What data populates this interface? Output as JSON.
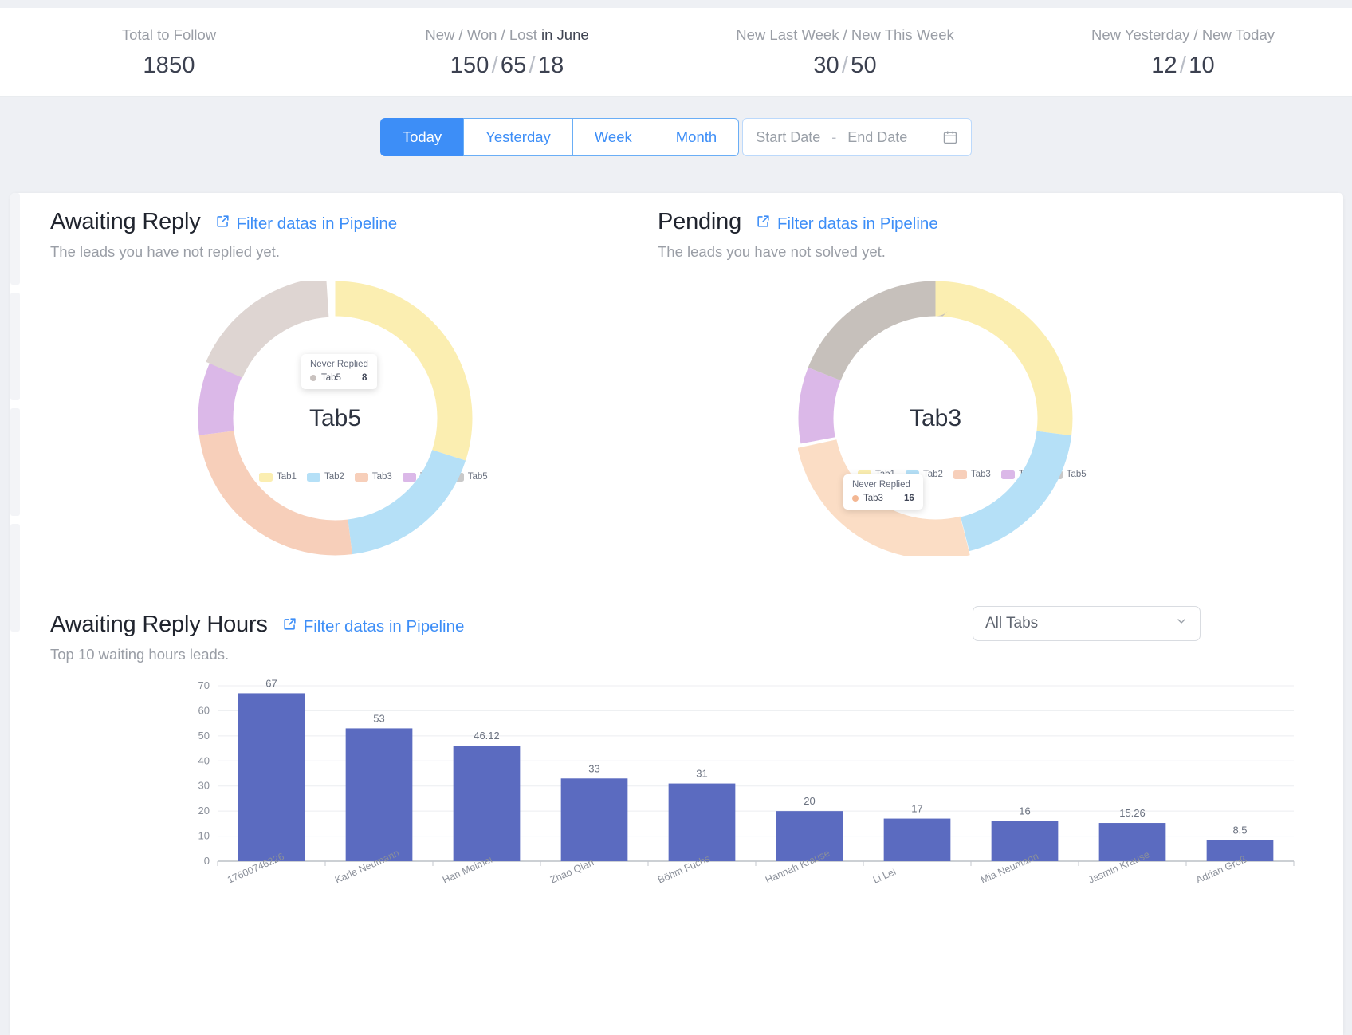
{
  "stats": [
    {
      "label_plain": "Total to Follow",
      "label_strong": "",
      "value": "1850",
      "parts": []
    },
    {
      "label_plain": "New / Won / Lost ",
      "label_strong": "in June",
      "value": "",
      "parts": [
        "150",
        "65",
        "18"
      ]
    },
    {
      "label_plain": "New Last Week / New This Week",
      "label_strong": "",
      "value": "",
      "parts": [
        "30",
        "50"
      ]
    },
    {
      "label_plain": "New Yesterday / New Today",
      "label_strong": "",
      "value": "",
      "parts": [
        "12",
        "10"
      ]
    }
  ],
  "filters": {
    "segments": [
      {
        "label": "Today",
        "active": true
      },
      {
        "label": "Yesterday",
        "active": false
      },
      {
        "label": "Week",
        "active": false
      },
      {
        "label": "Month",
        "active": false
      }
    ],
    "start_date_placeholder": "Start Date",
    "range_dash": "-",
    "end_date_placeholder": "End Date",
    "calendar_icon": "calendar-icon"
  },
  "colors": {
    "accent_blue": "#3d8ef7",
    "bar_purple": "#5b6bc0",
    "tab1": "#fbeeb1",
    "tab2": "#b5e0f7",
    "tab3": "#f7cfba",
    "tab4": "#dbb8e8",
    "tab5": "#ded5d2",
    "tab5_pending": "#c6c0bb",
    "tab3_pending": "#fbddc5"
  },
  "awaiting_reply": {
    "title": "Awaiting Reply",
    "link": "Filter datas in Pipeline",
    "subtitle": "The leads you have not replied yet.",
    "center_label": "Tab5",
    "tooltip": {
      "title": "Never Replied",
      "name": "Tab5",
      "value": "8"
    },
    "legend": [
      "Tab1",
      "Tab2",
      "Tab3",
      "Tab4",
      "Tab5"
    ]
  },
  "pending": {
    "title": "Pending",
    "link": "Filter datas in Pipeline",
    "subtitle": "The leads you have not solved yet.",
    "center_label": "Tab3",
    "tooltip": {
      "title": "Never Replied",
      "name": "Tab3",
      "value": "16"
    },
    "legend": [
      "Tab1",
      "Tab2",
      "Tab3",
      "Tab4",
      "Tab5"
    ]
  },
  "awaiting_hours": {
    "title": "Awaiting Reply Hours",
    "link": "Filter datas in Pipeline",
    "subtitle": "Top 10 waiting hours leads.",
    "tabs_filter_value": "All Tabs"
  },
  "chart_data": [
    {
      "type": "pie",
      "title": "Awaiting Reply",
      "legend_position": "top",
      "center_label": "Tab5",
      "labels": [
        "Tab1",
        "Tab2",
        "Tab3",
        "Tab4",
        "Tab5"
      ],
      "values": [
        30,
        18,
        25,
        9,
        18
      ],
      "colors": [
        "#fbeeb1",
        "#b5e0f7",
        "#f7cfba",
        "#dbb8e8",
        "#ded5d2"
      ],
      "highlighted": "Tab5",
      "annotation": {
        "title": "Never Replied",
        "series": "Tab5",
        "value": 8
      }
    },
    {
      "type": "pie",
      "title": "Pending",
      "legend_position": "top",
      "center_label": "Tab3",
      "labels": [
        "Tab1",
        "Tab2",
        "Tab3",
        "Tab4",
        "Tab5"
      ],
      "values": [
        27,
        19,
        26,
        9,
        19
      ],
      "colors": [
        "#fbeeb1",
        "#b5e0f7",
        "#fbddc5",
        "#dbb8e8",
        "#c6c0bb"
      ],
      "highlighted": "Tab3",
      "annotation": {
        "title": "Never Replied",
        "series": "Tab3",
        "value": 16
      }
    },
    {
      "type": "bar",
      "title": "Awaiting Reply Hours",
      "subtitle": "Top 10 waiting hours leads.",
      "xlabel": "",
      "ylabel": "",
      "ylim": [
        0,
        70
      ],
      "yticks": [
        0,
        10,
        20,
        30,
        40,
        50,
        60,
        70
      ],
      "grid": true,
      "legend_position": "none",
      "bar_color": "#5b6bc0",
      "categories": [
        "17600746226",
        "Karle Neumann",
        "Han Meimei",
        "Zhao Qian",
        "Böhm Fuchs",
        "Hannah Krause",
        "Li Lei",
        "Mia Neumann",
        "Jasmin Krause",
        "Adrian Groß"
      ],
      "values": [
        67,
        53,
        46.12,
        33,
        31,
        20,
        17,
        16,
        15.26,
        8.5
      ],
      "value_labels": [
        "67",
        "53",
        "46.12",
        "33",
        "31",
        "20",
        "17",
        "16",
        "15.26",
        "8.5"
      ]
    }
  ]
}
